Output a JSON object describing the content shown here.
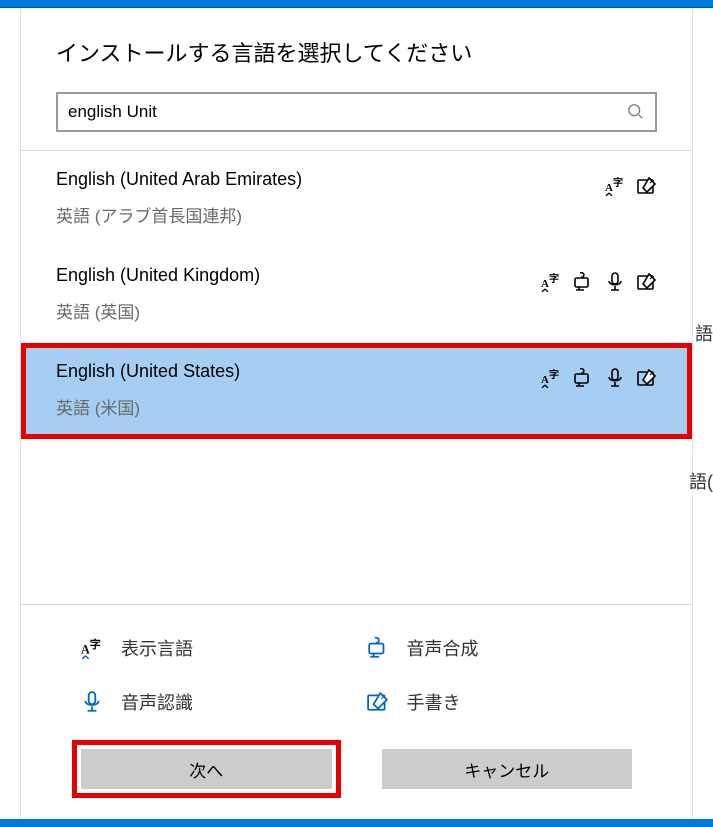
{
  "title": "インストールする言語を選択してください",
  "search": {
    "value": "english Unit",
    "placeholder": ""
  },
  "languages": [
    {
      "name": "English (United Arab Emirates)",
      "native": "英語 (アラブ首長国連邦)",
      "features": [
        "display",
        "handwriting"
      ],
      "selected": false
    },
    {
      "name": "English (United Kingdom)",
      "native": "英語 (英国)",
      "features": [
        "display",
        "tts",
        "speech",
        "handwriting"
      ],
      "selected": false
    },
    {
      "name": "English (United States)",
      "native": "英語 (米国)",
      "features": [
        "display",
        "tts",
        "speech",
        "handwriting"
      ],
      "selected": true
    }
  ],
  "legend": {
    "display": "表示言語",
    "tts": "音声合成",
    "speech": "音声認識",
    "handwriting": "手書き"
  },
  "buttons": {
    "next": "次へ",
    "cancel": "キャンセル"
  },
  "remnants": {
    "r1": "語",
    "r2": "語("
  }
}
